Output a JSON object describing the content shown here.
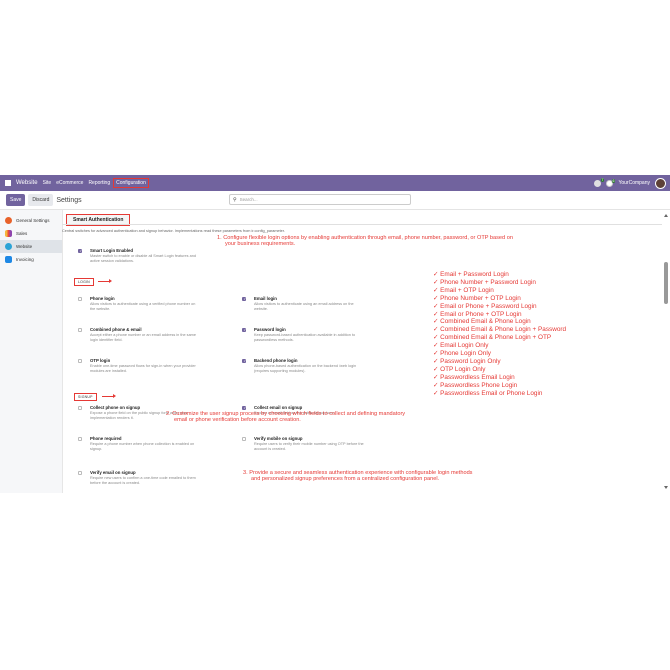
{
  "navbar": {
    "brand": "Website",
    "menu": [
      "Site",
      "eCommerce",
      "Reporting"
    ],
    "active_menu": "Configuration",
    "company": "YourCompany",
    "chat_badge": "7",
    "activity_badge": "6"
  },
  "control_panel": {
    "save_label": "Save",
    "discard_label": "Discard",
    "title": "Settings",
    "search_placeholder": "Search..."
  },
  "sidebar": {
    "items": [
      {
        "label": "General Settings",
        "icon": "settings-app-icon",
        "color": "#e8622a"
      },
      {
        "label": "Sales",
        "icon": "sales-app-icon",
        "color": "#e84a3f"
      },
      {
        "label": "Website",
        "icon": "website-app-icon",
        "color": "#2ba3d6",
        "active": true
      },
      {
        "label": "Invoicing",
        "icon": "invoicing-app-icon",
        "color": "#1e88e5"
      }
    ]
  },
  "main": {
    "section_title": "Smart Authentication",
    "intro": "Central switches for advanced authentication and signup behavior. Implementations read these parameters from ir.config_parameter.",
    "master": {
      "title": "Smart Login Enabled",
      "desc1": "Master switch to enable or disable all Smart Login features and",
      "desc2": "active session validations.",
      "checked": true
    },
    "login_label": "LOGIN",
    "signup_label": "SIGNUP",
    "login_settings": [
      {
        "title": "Phone login",
        "desc1": "Allow visitors to authenticate using a verified phone number on",
        "desc2": "the website.",
        "checked": false
      },
      {
        "title": "Email login",
        "desc1": "Allow visitors to authenticate using an email address on the",
        "desc2": "website.",
        "checked": true
      },
      {
        "title": "Combined phone & email",
        "desc1": "Accept either a phone number or an email address in the same",
        "desc2": "login identifier field.",
        "checked": false
      },
      {
        "title": "Password login",
        "desc1": "Keep password-based authentication available in addition to",
        "desc2": "passwordless methods.",
        "checked": true
      },
      {
        "title": "OTP login",
        "desc1": "Enable one-time password flows for sign-in when your provider",
        "desc2": "modules are installed.",
        "checked": false
      },
      {
        "title": "Backend phone login",
        "desc1": "Allow phone-based authentication on the backend /web login",
        "desc2": "(requires supporting modules).",
        "checked": true
      }
    ],
    "signup_settings": [
      {
        "title": "Collect phone on signup",
        "desc1": "Expose a phone field on the public signup form when your",
        "desc2": "implementation renders it.",
        "checked": false
      },
      {
        "title": "Collect email on signup",
        "desc1": "Expose an email field on the public signup form.",
        "desc2": "",
        "checked": true
      },
      {
        "title": "Phone required",
        "desc1": "Require a phone number when phone collection is enabled on",
        "desc2": "signup.",
        "checked": false
      },
      {
        "title": "Verify mobile on signup",
        "desc1": "Require users to verify their mobile number using OTP before the",
        "desc2": "account is created.",
        "checked": false
      },
      {
        "title": "Verify email on signup",
        "desc1": "Require new users to confirm a one-time code emailed to them",
        "desc2": "before the account is created.",
        "checked": false
      }
    ]
  },
  "annotations": {
    "note1_line1": "1. Configure flexible login options by enabling authentication through email, phone number, password, or OTP based on",
    "note1_line2": "your business requirements.",
    "note2_line1": "2. Customize the user signup process by choosing which fields to collect and defining mandatory",
    "note2_line2": "email or phone verification before account creation.",
    "note3_line1": "3. Provide a secure and seamless authentication experience with configurable login methods",
    "note3_line2": "and personalized signup preferences from a centralized configuration panel.",
    "features": [
      "✓ Email + Password Login",
      "✓ Phone Number + Password Login",
      "✓ Email + OTP Login",
      "✓ Phone Number + OTP Login",
      "✓ Email or Phone + Password Login",
      "✓ Email or Phone + OTP Login",
      "✓ Combined Email & Phone Login",
      "✓ Combined Email & Phone Login + Password",
      "✓ Combined Email & Phone Login + OTP",
      "✓ Email Login Only",
      "✓ Phone Login Only",
      "✓ Password Login Only",
      "✓ OTP Login Only",
      "✓ Passwordless Email Login",
      "✓ Passwordless Phone Login",
      "✓ Passwordless Email or Phone Login"
    ],
    "color": "#e53935"
  },
  "theme": {
    "primary": "#71639e"
  }
}
